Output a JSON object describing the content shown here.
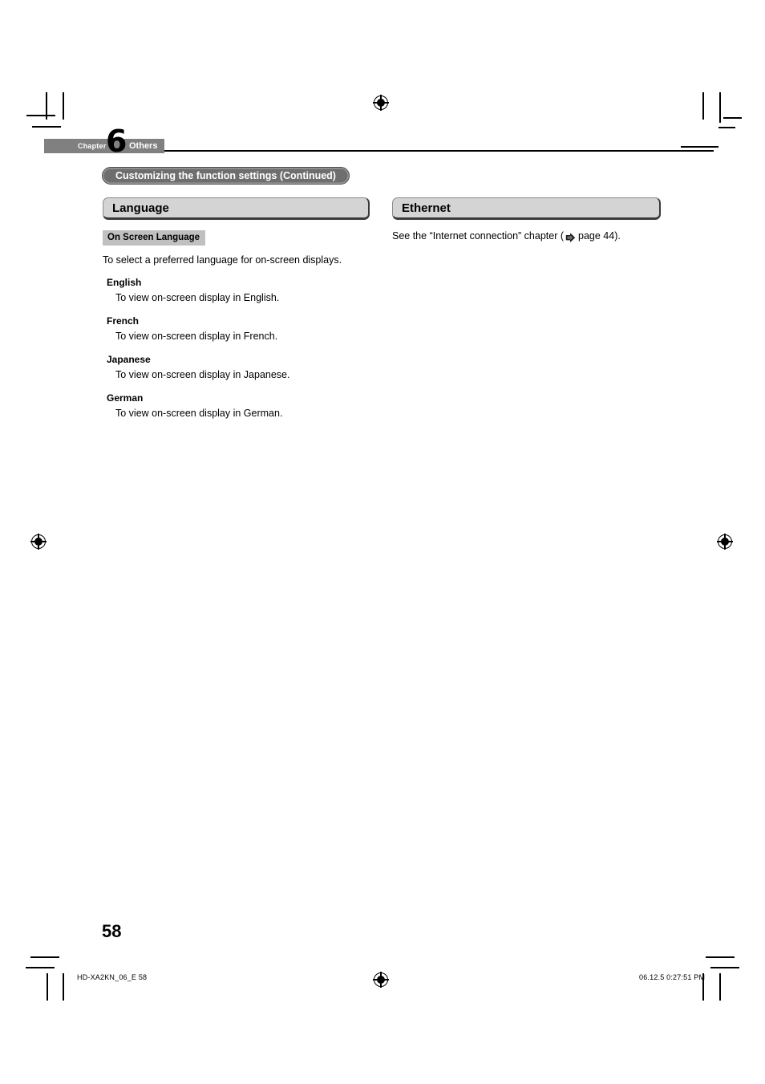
{
  "page": {
    "number": "58",
    "chapter_label": "Chapter",
    "chapter_number": "6",
    "chapter_name": "Others",
    "section_breadcrumb": "Customizing the function settings (Continued)"
  },
  "left_column": {
    "title": "Language",
    "badge": "On Screen Language",
    "intro": "To select a preferred language for on-screen displays.",
    "entries": [
      {
        "term": "English",
        "description": "To view on-screen display in English."
      },
      {
        "term": "French",
        "description": "To view on-screen display in French."
      },
      {
        "term": "Japanese",
        "description": "To view on-screen display in Japanese."
      },
      {
        "term": "German",
        "description": "To view on-screen display in German."
      }
    ]
  },
  "right_column": {
    "title": "Ethernet",
    "reference": {
      "before_icon": "See the “Internet connection” chapter (",
      "icon": "right-arrow-icon",
      "after_icon": "page 44)."
    }
  },
  "footer": {
    "left": "HD-XA2KN_06_E  58",
    "right": "06.12.5  0:27:51 PM"
  },
  "colors": {
    "chapter_bar": "#808080",
    "pill": "#6e6e6e",
    "section_bar": "#d4d4d4",
    "badge": "#c0c0c0",
    "text": "#000000"
  }
}
